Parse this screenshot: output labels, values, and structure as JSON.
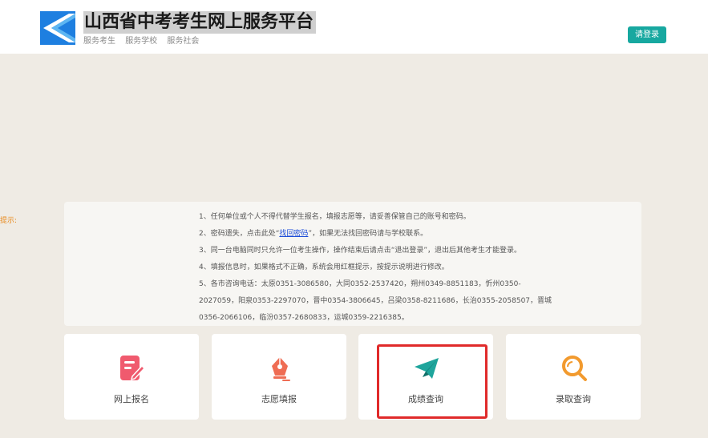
{
  "header": {
    "title": "山西省中考考生网上服务平台",
    "subnav": [
      "服务考生",
      "服务学校",
      "服务社会"
    ],
    "login_label": "请登录"
  },
  "tip_label": "提示:",
  "notice": {
    "item1": "1、任何单位或个人不得代替学生报名，填报志愿等，请妥善保管自己的账号和密码。",
    "item2_before": "2、密码遗失，点击此处“",
    "item2_link": "找回密码",
    "item2_after": "”，如果无法找回密码请与学校联系。",
    "item3": "3、同一台电脑同时只允许一位考生操作，操作结束后请点击“退出登录”，退出后其他考生才能登录。",
    "item4": "4、填报信息时，如果格式不正确，系统会用红框提示，按提示说明进行修改。",
    "item5_line1": "5、各市咨询电话：太原0351-3086580，大同0352-2537420，朔州0349-8851183，忻州0350-",
    "item5_line2": "2027059，阳泉0353-2297070，晋中0354-3806645，吕梁0358-8211686，长治0355-2058507，晋城",
    "item5_line3": "0356-2066106，临汾0357-2680833，运城0359-2216385。"
  },
  "cards": [
    {
      "label": "网上报名",
      "icon": "edit-form-icon",
      "color": "#f05a6e"
    },
    {
      "label": "志愿填报",
      "icon": "pen-nib-icon",
      "color": "#ef6d54"
    },
    {
      "label": "成绩查询",
      "icon": "paper-plane-icon",
      "color": "#1fa59c"
    },
    {
      "label": "录取查询",
      "icon": "magnifier-icon",
      "color": "#f29a2e"
    }
  ],
  "colors": {
    "accent": "#17a8a0",
    "logo_blue": "#1e7fe0",
    "highlight": "#e02a2a",
    "tip": "#e8891b",
    "page_background": "#efebe4"
  }
}
